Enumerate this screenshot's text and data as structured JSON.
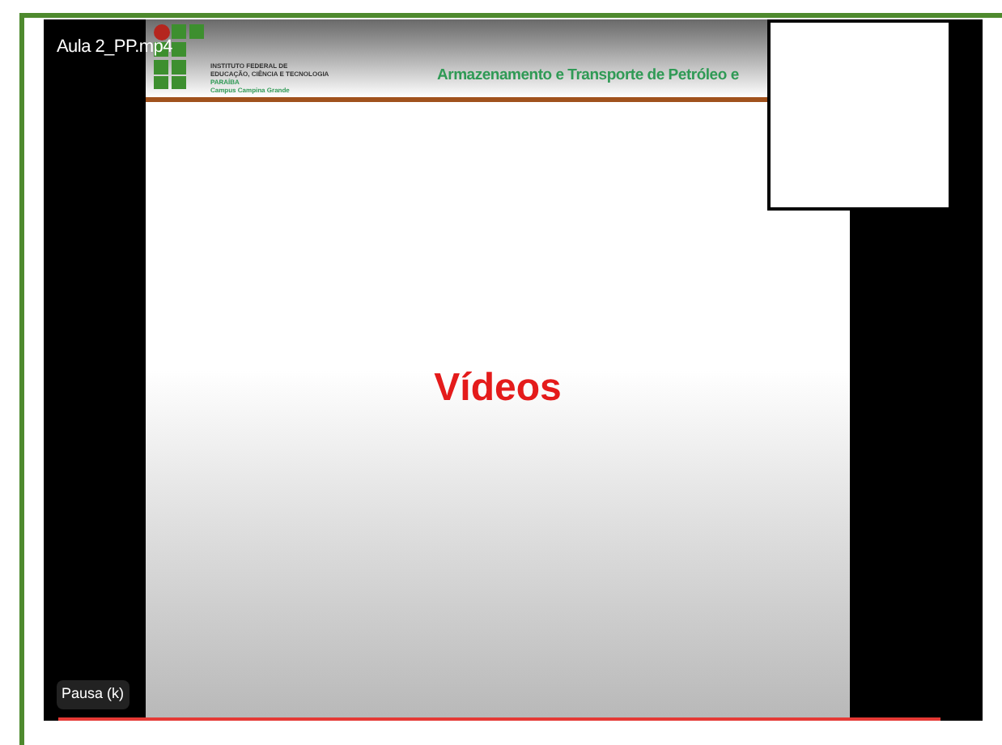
{
  "video": {
    "file_name": "Aula 2_PP.mp4",
    "tooltip": "Pausa (k)",
    "progress": {
      "level": 0.97
    }
  },
  "slide": {
    "institute_lines": [
      "INSTITUTO FEDERAL DE",
      "EDUCAÇÃO, CIÊNCIA E TECNOLOGIA",
      "PARAÍBA",
      "Campus Campina Grande"
    ],
    "header_title": "Armazenamento e Transporte de Petróleo e",
    "heading": "Vídeos"
  }
}
